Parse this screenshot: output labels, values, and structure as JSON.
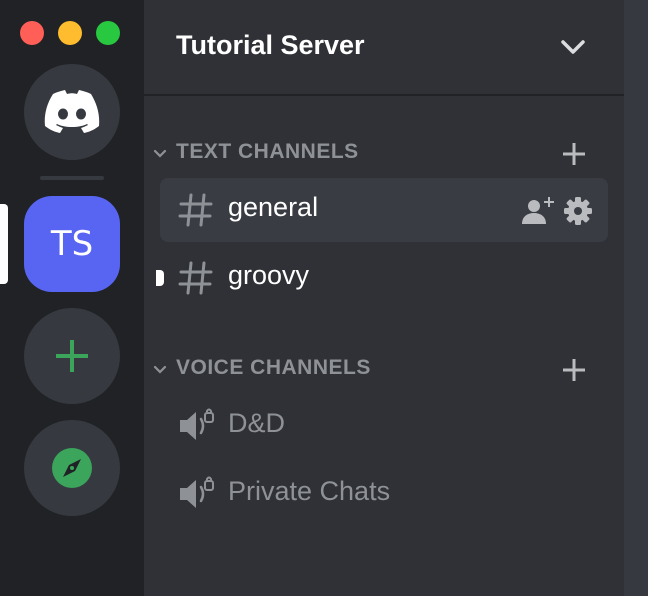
{
  "window": {
    "traffic_lights": [
      "close",
      "minimize",
      "zoom"
    ]
  },
  "server_rail": {
    "home_icon": "discord-logo-icon",
    "active_server_initials": "TS",
    "add_icon": "plus-icon",
    "explore_icon": "compass-icon",
    "colors": {
      "active": "#5865f2",
      "add": "#3ba55c",
      "explore": "#3ba55c"
    }
  },
  "sidebar": {
    "server_name": "Tutorial Server",
    "header_icon": "chevron-down-icon",
    "categories": [
      {
        "label": "TEXT CHANNELS",
        "channels": [
          {
            "name": "general",
            "icon": "hash-icon",
            "selected": true,
            "actions": [
              "invite-icon",
              "gear-icon"
            ]
          },
          {
            "name": "groovy",
            "icon": "hash-icon",
            "unread": true
          }
        ]
      },
      {
        "label": "VOICE CHANNELS",
        "channels": [
          {
            "name": "D&D",
            "icon": "speaker-icon"
          },
          {
            "name": "Private Chats",
            "icon": "speaker-icon"
          }
        ]
      }
    ]
  },
  "theme": {
    "rail_bg": "#202225",
    "sidebar_bg": "#2f3136",
    "selected_bg": "#393c43",
    "muted_text": "#8e9297"
  }
}
